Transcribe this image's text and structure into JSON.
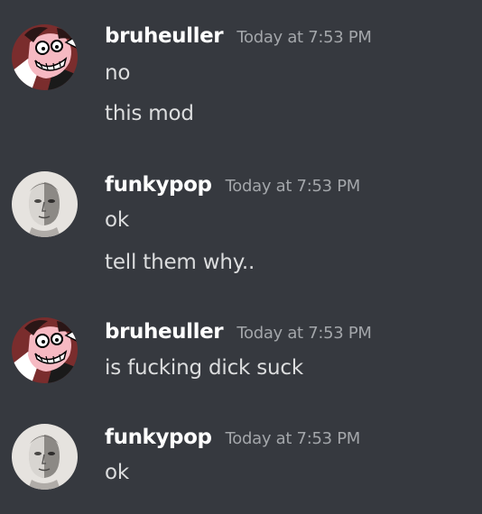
{
  "messages": [
    {
      "username": "bruheuller",
      "timestamp": "Today at 7:53 PM",
      "avatar": "cartoon-avatar-icon",
      "lines": [
        "no",
        "this mod"
      ]
    },
    {
      "username": "funkypop",
      "timestamp": "Today at 7:53 PM",
      "avatar": "face-photo-avatar-icon",
      "lines": [
        "ok",
        "tell them why.."
      ]
    },
    {
      "username": "bruheuller",
      "timestamp": "Today at 7:53 PM",
      "avatar": "cartoon-avatar-icon",
      "lines": [
        "is fucking dick suck"
      ]
    },
    {
      "username": "funkypop",
      "timestamp": "Today at 7:53 PM",
      "avatar": "face-photo-avatar-icon",
      "lines": [
        "ok"
      ]
    }
  ],
  "colors": {
    "background": "#36393f",
    "username": "#ffffff",
    "timestamp": "#a3a6aa",
    "message": "#dcddde"
  }
}
